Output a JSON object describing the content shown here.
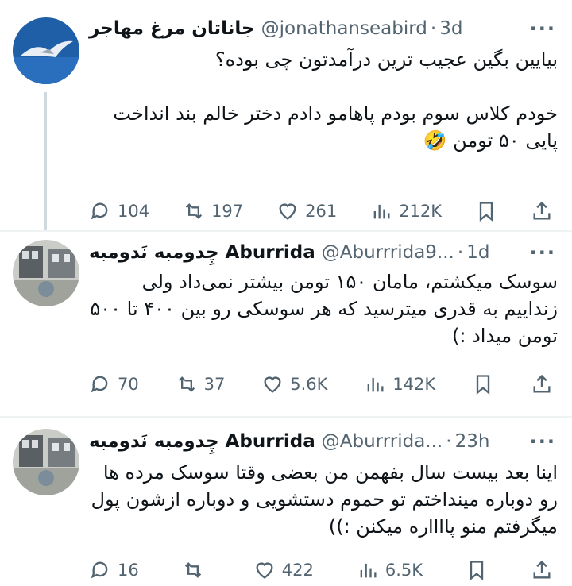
{
  "tweets": [
    {
      "name": "جاناتان مرغ مهاجر",
      "handle": "@jonathanseabird",
      "time": "3d",
      "text": "بیایین بگین عجیب ترین درآمدتون چی بوده؟\n\nخودم کلاس سوم بودم پاهامو دادم دختر خالم بند انداخت\nپایی ۵۰ تومن 🤣",
      "replies": "104",
      "retweets": "197",
      "likes": "261",
      "views": "212K"
    },
    {
      "name": "چِدومبه نَدومبه Aburrida",
      "handle": "@Aburrrida9...",
      "time": "1d",
      "text": "سوسک میکشتم، مامان ۱۵۰ تومن بیشتر نمی‌داد ولی زنداییم به قدری میترسید که هر سوسکی رو بین ۴۰۰ تا ۵۰۰ تومن میداد :)",
      "replies": "70",
      "retweets": "37",
      "likes": "5.6K",
      "views": "142K"
    },
    {
      "name": "چِدومبه نَدومبه Aburrida",
      "handle": "@Aburrrida...",
      "time": "23h",
      "text": "اینا بعد بیست سال بفهمن من بعضی وقتا سوسک مرده ها رو دوباره مینداختم تو حموم دستشویی و دوباره ازشون پول میگرفتم منو پااااره میکنن :))",
      "replies": "16",
      "retweets": "",
      "likes": "422",
      "views": "6.5K"
    }
  ],
  "separator": "·",
  "more_label": "···"
}
